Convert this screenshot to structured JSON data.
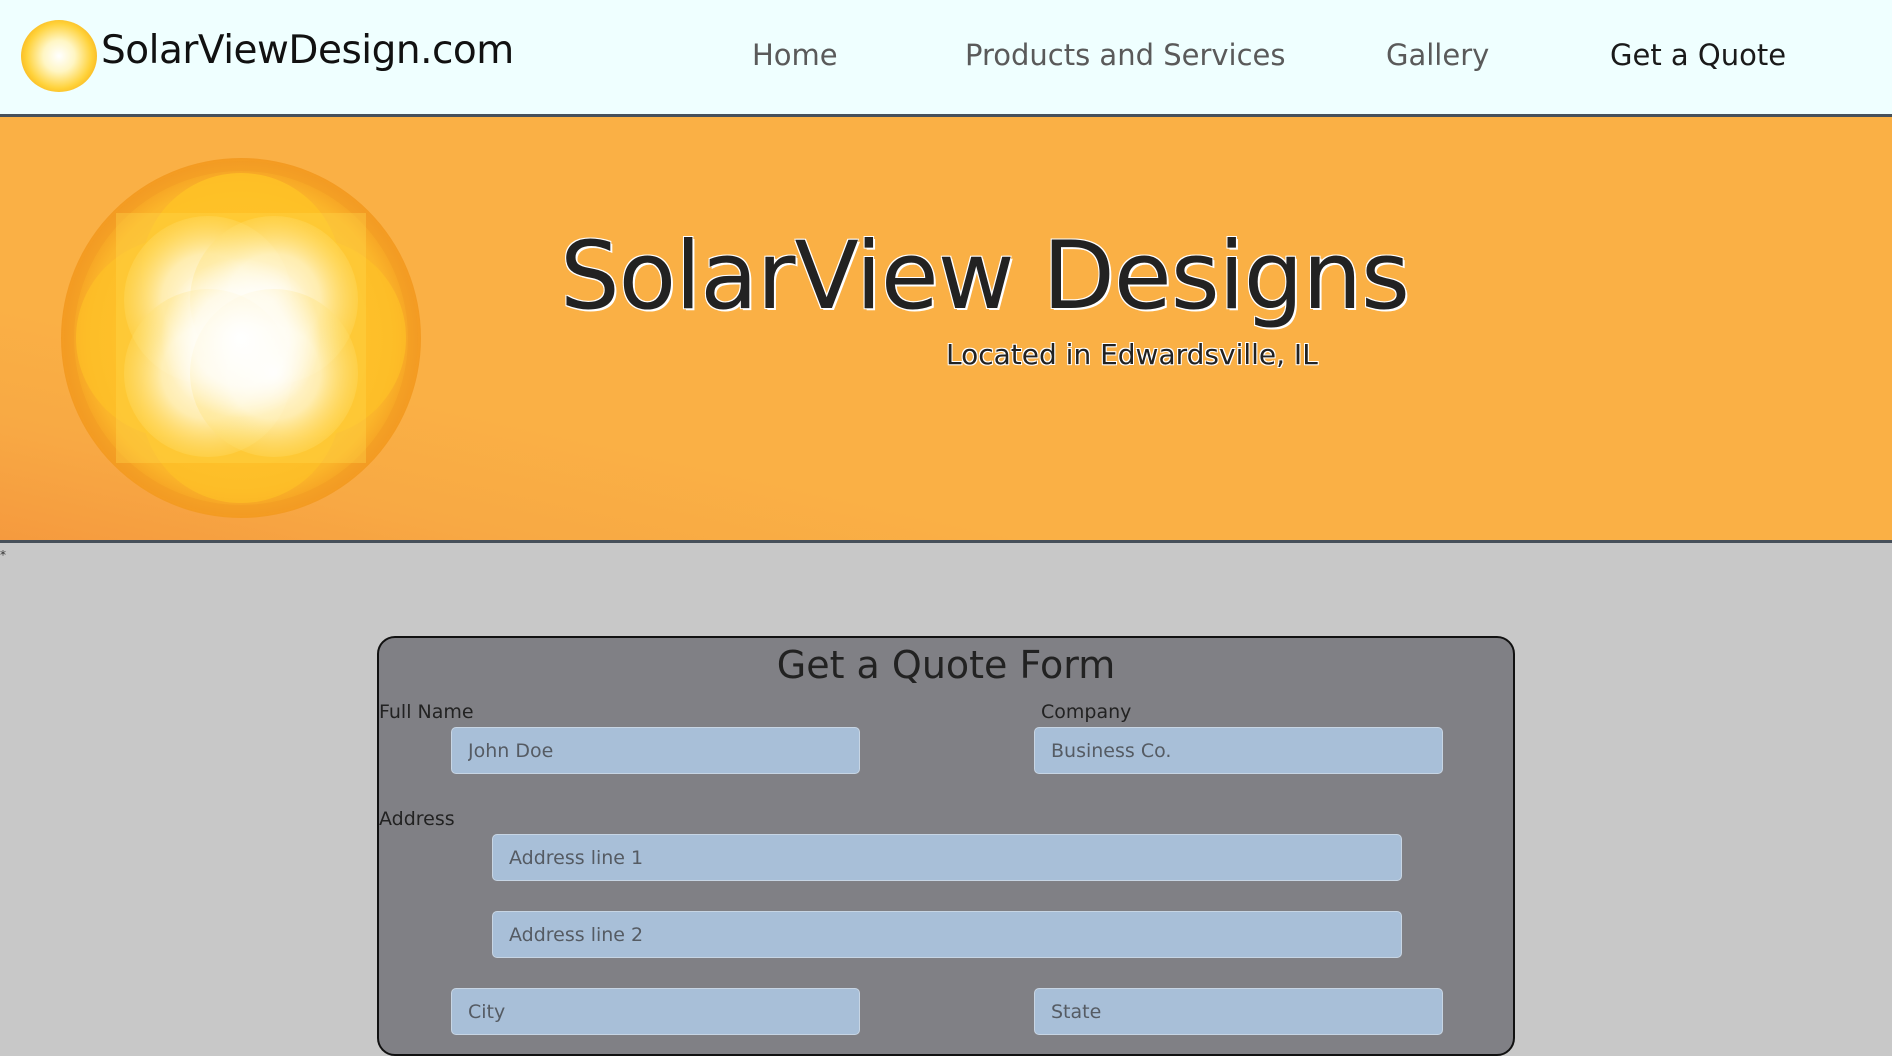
{
  "navbar": {
    "brand": "SolarViewDesign.com",
    "links": [
      "Home",
      "Products and Services",
      "Gallery",
      "Get a Quote"
    ]
  },
  "hero": {
    "title": "SolarView Designs",
    "subtitle": "Located in Edwardsville, IL"
  },
  "stray_mark": "*",
  "form": {
    "title": "Get a Quote Form",
    "labels": {
      "full_name": "Full Name",
      "company": "Company",
      "address": "Address"
    },
    "placeholders": {
      "full_name": "John Doe",
      "company": "Business Co.",
      "address1": "Address line 1",
      "address2": "Address line 2",
      "city": "City",
      "state": "State"
    }
  },
  "colors": {
    "nav_bg": "#efffff",
    "hero_bg": "#fab045",
    "page_bg": "#c8c8c8",
    "card_bg": "#808085",
    "input_bg": "#a8bfd8"
  }
}
